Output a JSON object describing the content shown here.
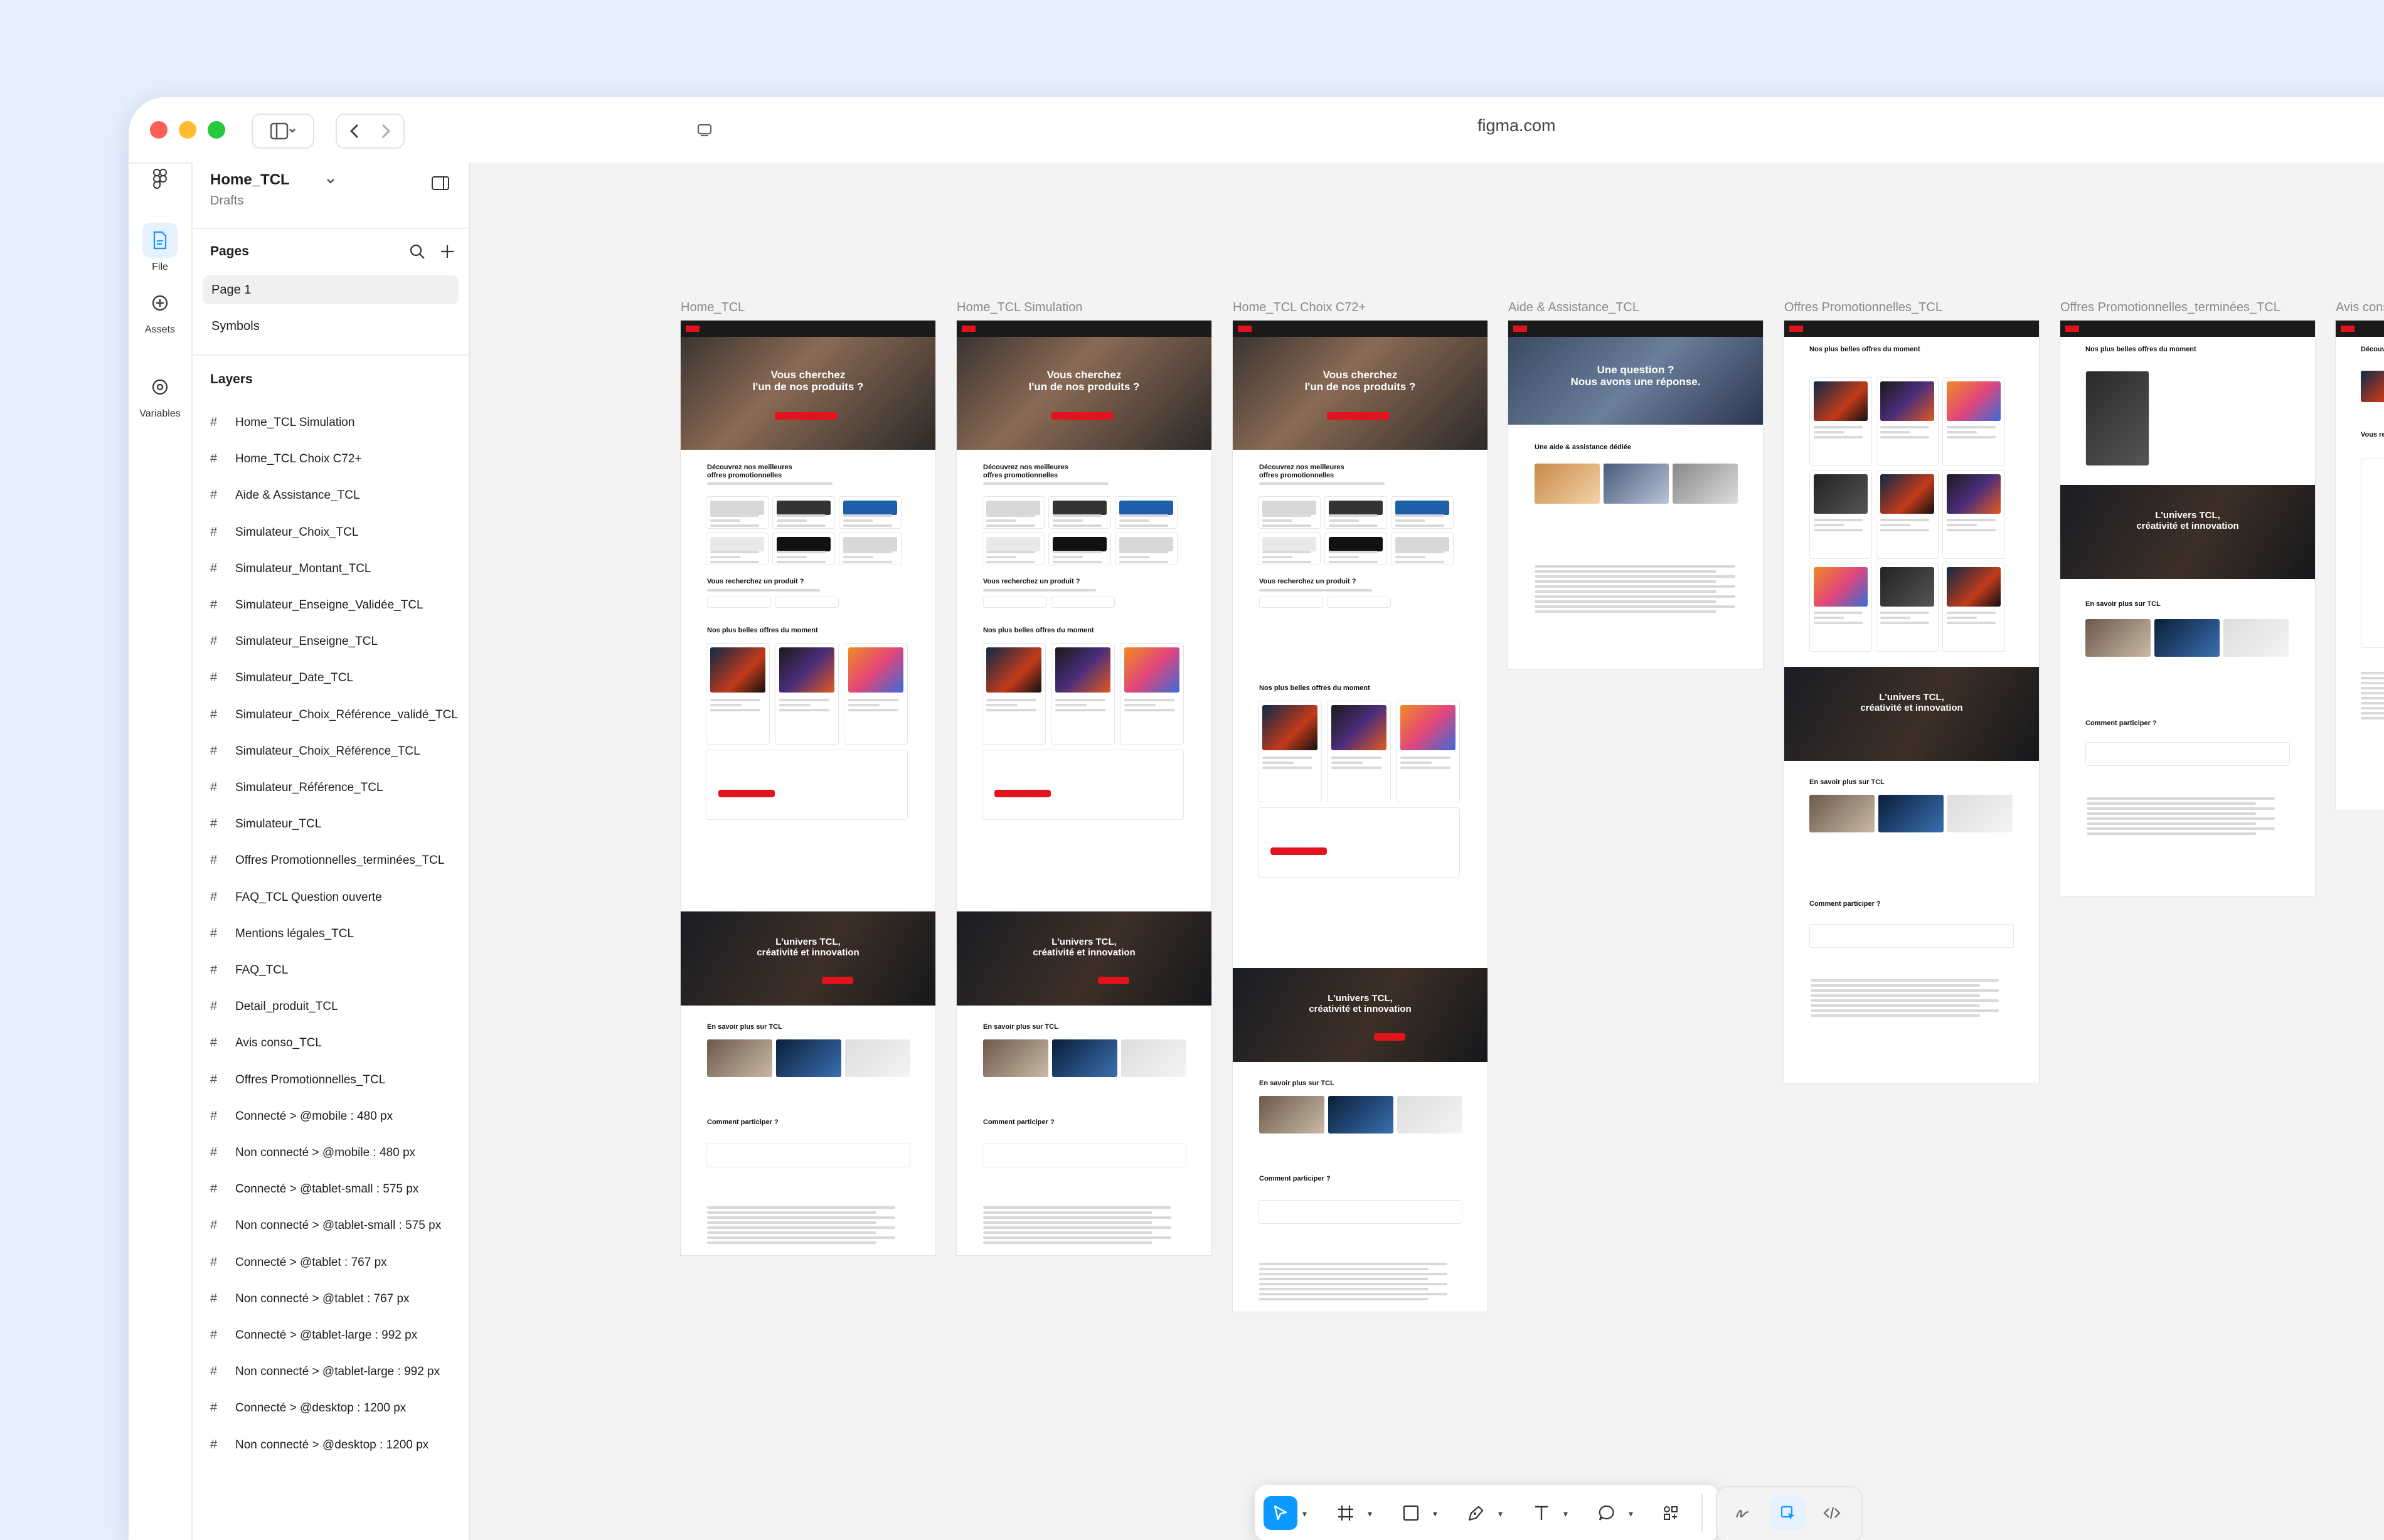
{
  "browser": {
    "url": "figma.com"
  },
  "file": {
    "name": "Home_TCL",
    "location": "Drafts"
  },
  "rail": {
    "file": "File",
    "assets": "Assets",
    "variables": "Variables"
  },
  "pages": {
    "heading": "Pages",
    "items": [
      "Page 1",
      "Symbols"
    ]
  },
  "layers": {
    "heading": "Layers",
    "items": [
      "Home_TCL Simulation",
      "Home_TCL Choix C72+",
      "Aide & Assistance_TCL",
      "Simulateur_Choix_TCL",
      "Simulateur_Montant_TCL",
      "Simulateur_Enseigne_Validée_TCL",
      "Simulateur_Enseigne_TCL",
      "Simulateur_Date_TCL",
      "Simulateur_Choix_Référence_validé_TCL",
      "Simulateur_Choix_Référence_TCL",
      "Simulateur_Référence_TCL",
      "Simulateur_TCL",
      "Offres Promotionnelles_terminées_TCL",
      "FAQ_TCL Question ouverte",
      "Mentions légales_TCL",
      "FAQ_TCL",
      "Detail_produit_TCL",
      "Avis conso_TCL",
      "Offres Promotionnelles_TCL",
      "Connecté > @mobile : 480 px",
      "Non connecté > @mobile : 480 px",
      "Connecté > @tablet-small : 575 px",
      "Non connecté > @tablet-small : 575 px",
      "Connecté > @tablet : 767 px",
      "Non connecté > @tablet : 767 px",
      "Connecté > @tablet-large : 992 px",
      "Non connecté > @tablet-large : 992 px",
      "Connecté > @desktop : 1200 px",
      "Non connecté > @desktop : 1200 px"
    ]
  },
  "frames": [
    {
      "label": "Home_TCL"
    },
    {
      "label": "Home_TCL Simulation"
    },
    {
      "label": "Home_TCL Choix C72+"
    },
    {
      "label": "Aide & Assistance_TCL"
    },
    {
      "label": "Offres Promotionnelles_TCL"
    },
    {
      "label": "Offres Promotionnelles_terminées_TCL"
    },
    {
      "label": "Avis conso_TCL"
    }
  ],
  "frame_text": {
    "hero_question": "Vous cherchez\nl'un de nos produits ?",
    "hero_help": "Une question ?\nNous avons une réponse.",
    "univers": "L'univers TCL,\ncréativité et innovation",
    "discover": "Découvrez nos meilleures\noffres promotionnelles",
    "search": "Vous recherchez un produit ?",
    "best_offers": "Nos plus belles offres du moment",
    "learn_more": "En savoir plus sur TCL",
    "participate": "Comment participer ?",
    "help_title": "Une aide & assistance dédiée",
    "reviews_title": "Découvrez les produits TCL les mieux notés",
    "review_search": "Vous recherchez un avis en particulier ?"
  },
  "colors": {
    "accent": "#0d99ff",
    "tcl_red": "#e1141e",
    "canvas": "#f3f3f3"
  }
}
